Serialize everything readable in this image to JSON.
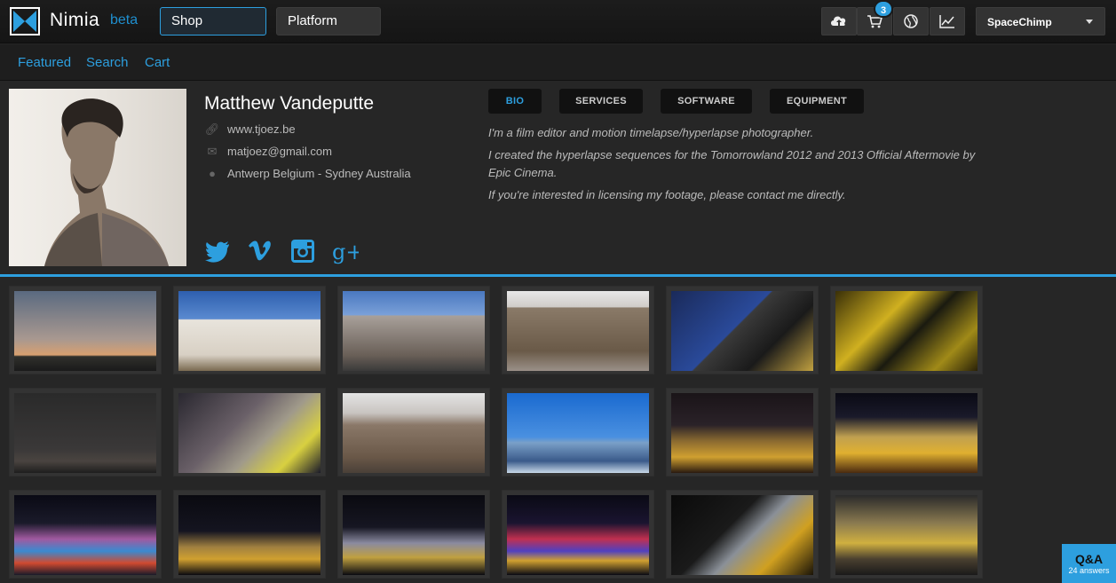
{
  "brand": {
    "name": "Nimia",
    "tag": "beta"
  },
  "topnav": {
    "shop": "Shop",
    "platform": "Platform"
  },
  "cart_count": "3",
  "user": {
    "name": "SpaceChimp"
  },
  "subnav": {
    "featured": "Featured",
    "search": "Search",
    "cart": "Cart"
  },
  "profile": {
    "name": "Matthew Vandeputte",
    "website": "www.tjoez.be",
    "email": "matjoez@gmail.com",
    "location": "Antwerp Belgium - Sydney Australia"
  },
  "tabs": [
    "BIO",
    "SERVICES",
    "SOFTWARE",
    "EQUIPMENT"
  ],
  "bio": [
    "I'm a film editor and motion timelapse/hyperlapse photographer.",
    "I created the hyperlapse sequences for the Tomorrowland 2012 and 2013 Official Aftermovie by Epic Cinema.",
    "If you're interested in licensing my footage, please contact me directly."
  ],
  "qa": {
    "title": "Q&A",
    "subtitle": "24 answers"
  },
  "colors": {
    "accent": "#2d9fdf",
    "background": "#262626",
    "topbar": "#1a1a1a"
  }
}
